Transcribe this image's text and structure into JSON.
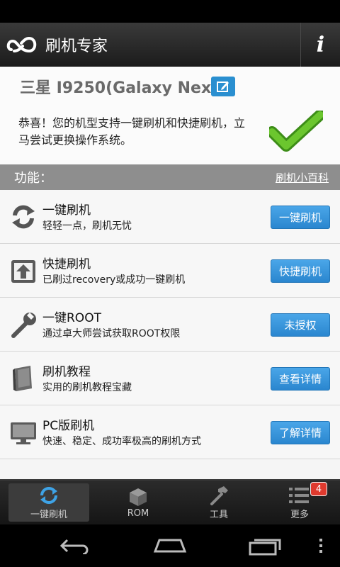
{
  "app_bar": {
    "title": "刷机专家",
    "info_label": "i"
  },
  "device": {
    "name": "三星 I9250(Galaxy Nex...",
    "support_message": "恭喜！您的机型支持一键刷机和快捷刷机，立马尝试更换操作系统。"
  },
  "section": {
    "title": "功能：",
    "wiki_link": "刷机小百科"
  },
  "features": [
    {
      "title": "一键刷机",
      "desc": "轻轻一点，刷机无忧",
      "action": "一键刷机",
      "icon": "refresh-icon"
    },
    {
      "title": "快捷刷机",
      "desc": "已刷过recovery或成功一键刷机",
      "action": "快捷刷机",
      "icon": "upload-icon"
    },
    {
      "title": "一键ROOT",
      "desc": "通过卓大师尝试获取ROOT权限",
      "action": "未授权",
      "icon": "wrench-icon"
    },
    {
      "title": "刷机教程",
      "desc": "实用的刷机教程宝藏",
      "action": "查看详情",
      "icon": "book-icon"
    },
    {
      "title": "PC版刷机",
      "desc": "快速、稳定、成功率极高的刷机方式",
      "action": "了解详情",
      "icon": "monitor-icon"
    }
  ],
  "tabs": [
    {
      "label": "一键刷机",
      "icon": "sync-icon"
    },
    {
      "label": "ROM",
      "icon": "box-icon"
    },
    {
      "label": "工具",
      "icon": "hammer-icon"
    },
    {
      "label": "更多",
      "icon": "list-icon",
      "badge": "4"
    }
  ],
  "colors": {
    "accent": "#2a86cf",
    "check": "#5fb82a",
    "badge": "#e03a2e"
  }
}
